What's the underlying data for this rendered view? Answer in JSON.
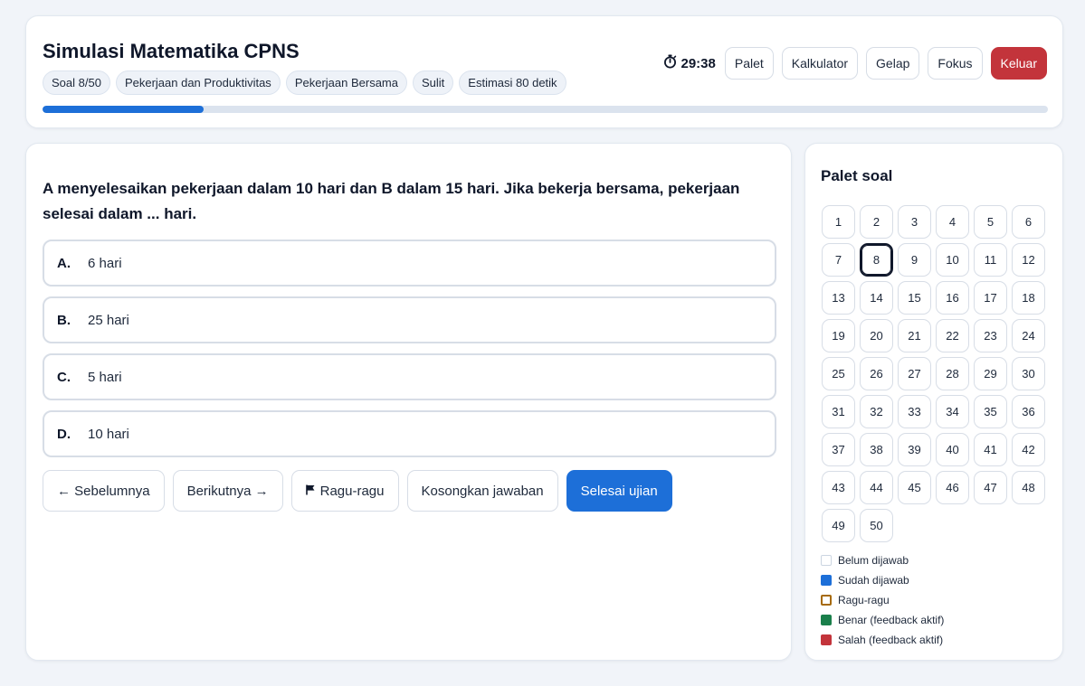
{
  "header": {
    "title": "Simulasi Matematika CPNS",
    "chips": [
      "Soal 8/50",
      "Pekerjaan dan Produktivitas",
      "Pekerjaan Bersama",
      "Sulit",
      "Estimasi 80 detik"
    ],
    "timer_icon": "stopwatch-icon",
    "timer": "29:38",
    "buttons": {
      "palette": "Palet",
      "calculator": "Kalkulator",
      "dark": "Gelap",
      "focus": "Fokus",
      "exit": "Keluar"
    },
    "progress_fraction": 0.16
  },
  "question": {
    "text": "A menyelesaikan pekerjaan dalam 10 hari dan B dalam 15 hari. Jika bekerja bersama, pekerjaan selesai dalam ... hari.",
    "options": [
      {
        "letter": "A.",
        "text": "6 hari"
      },
      {
        "letter": "B.",
        "text": "25 hari"
      },
      {
        "letter": "C.",
        "text": "5 hari"
      },
      {
        "letter": "D.",
        "text": "10 hari"
      }
    ]
  },
  "nav": {
    "prev": "← Sebelumnya",
    "next": "Berikutnya →",
    "flag_icon": "flag-icon",
    "doubt": "Ragu-ragu",
    "clear": "Kosongkan jawaban",
    "finish": "Selesai ujian"
  },
  "palette": {
    "title": "Palet soal",
    "numbers": [
      "1",
      "2",
      "3",
      "4",
      "5",
      "6",
      "7",
      "8",
      "9",
      "10",
      "11",
      "12",
      "13",
      "14",
      "15",
      "16",
      "17",
      "18",
      "19",
      "20",
      "21",
      "22",
      "23",
      "24",
      "25",
      "26",
      "27",
      "28",
      "29",
      "30",
      "31",
      "32",
      "33",
      "34",
      "35",
      "36",
      "37",
      "38",
      "39",
      "40",
      "41",
      "42",
      "43",
      "44",
      "45",
      "46",
      "47",
      "48",
      "49",
      "50"
    ],
    "current": "8",
    "legend": [
      {
        "label": "Belum dijawab",
        "color": "#ffffff",
        "border": "#cbd5e1"
      },
      {
        "label": "Sudah dijawab",
        "color": "#1d6fd8",
        "border": "#1d6fd8"
      },
      {
        "label": "Ragu-ragu",
        "color": "#ffffff",
        "border": "#a66a0a"
      },
      {
        "label": "Benar (feedback aktif)",
        "color": "#1a7f4b",
        "border": "#1a7f4b"
      },
      {
        "label": "Salah (feedback aktif)",
        "color": "#c3343b",
        "border": "#c3343b"
      }
    ]
  },
  "colors": {
    "accent": "#1d6fd8",
    "danger": "#c3343b"
  }
}
